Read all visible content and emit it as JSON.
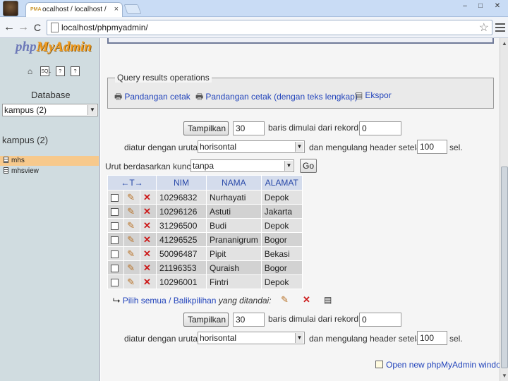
{
  "browser": {
    "tab_title": "ocalhost / localhost / kampus",
    "tab_favicon": "PMA",
    "url": "localhost/phpmyadmin/",
    "tab_close": "×",
    "back": "←",
    "forward": "→",
    "reload": "C",
    "star": "☆",
    "minimize": "–",
    "maximize": "□",
    "close": "✕"
  },
  "sidebar": {
    "logo_php": "php",
    "logo_myadmin": "MyAdmin",
    "icons": [
      "home-icon",
      "sql-icon",
      "docs-icon",
      "query-window-icon"
    ],
    "database_label": "Database",
    "database_select": "kampus (2)",
    "db_heading": "kampus (2)",
    "tables": [
      {
        "name": "mhs",
        "active": true
      },
      {
        "name": "mhsview",
        "active": false
      }
    ]
  },
  "main": {
    "query_ops": {
      "legend": "Query results operations",
      "print_view": "Pandangan cetak",
      "print_view_full": "Pandangan cetak (dengan teks lengkap)",
      "export": "Ekspor"
    },
    "nav_top": {
      "show_button": "Tampilkan",
      "rows": "30",
      "rows_from_label": "baris dimulai dari rekord #",
      "start": "0",
      "order_label": "diatur dengan urutan",
      "mode": "horisontal",
      "repeat_label": "dan mengulang header setelah",
      "repeat": "100",
      "cells_label": "sel."
    },
    "sort": {
      "label": "Urut berdasarkan kunci",
      "value": "tanpa",
      "go": "Go"
    },
    "table": {
      "headers": [
        "←T→",
        "NIM",
        "NAMA",
        "ALAMAT"
      ],
      "rows": [
        [
          "10296832",
          "Nurhayati",
          "Depok"
        ],
        [
          "10296126",
          "Astuti",
          "Jakarta"
        ],
        [
          "31296500",
          "Budi",
          "Depok"
        ],
        [
          "41296525",
          "Prananigrum",
          "Bogor"
        ],
        [
          "50096487",
          "Pipit",
          "Bekasi"
        ],
        [
          "21196353",
          "Quraish",
          "Bogor"
        ],
        [
          "10296001",
          "Fintri",
          "Depok"
        ]
      ]
    },
    "bulk": {
      "select_all": "Pilih semua / Balikpilihan",
      "with_selected": "yang ditandai:"
    },
    "nav_bottom": {
      "show_button": "Tampilkan",
      "rows": "30",
      "rows_from_label": "baris dimulai dari rekord #",
      "start": "0",
      "order_label": "diatur dengan urutan",
      "mode": "horisontal",
      "repeat_label": "dan mengulang header setelah",
      "repeat": "100",
      "cells_label": "sel."
    },
    "new_window": "Open new phpMyAdmin window"
  }
}
